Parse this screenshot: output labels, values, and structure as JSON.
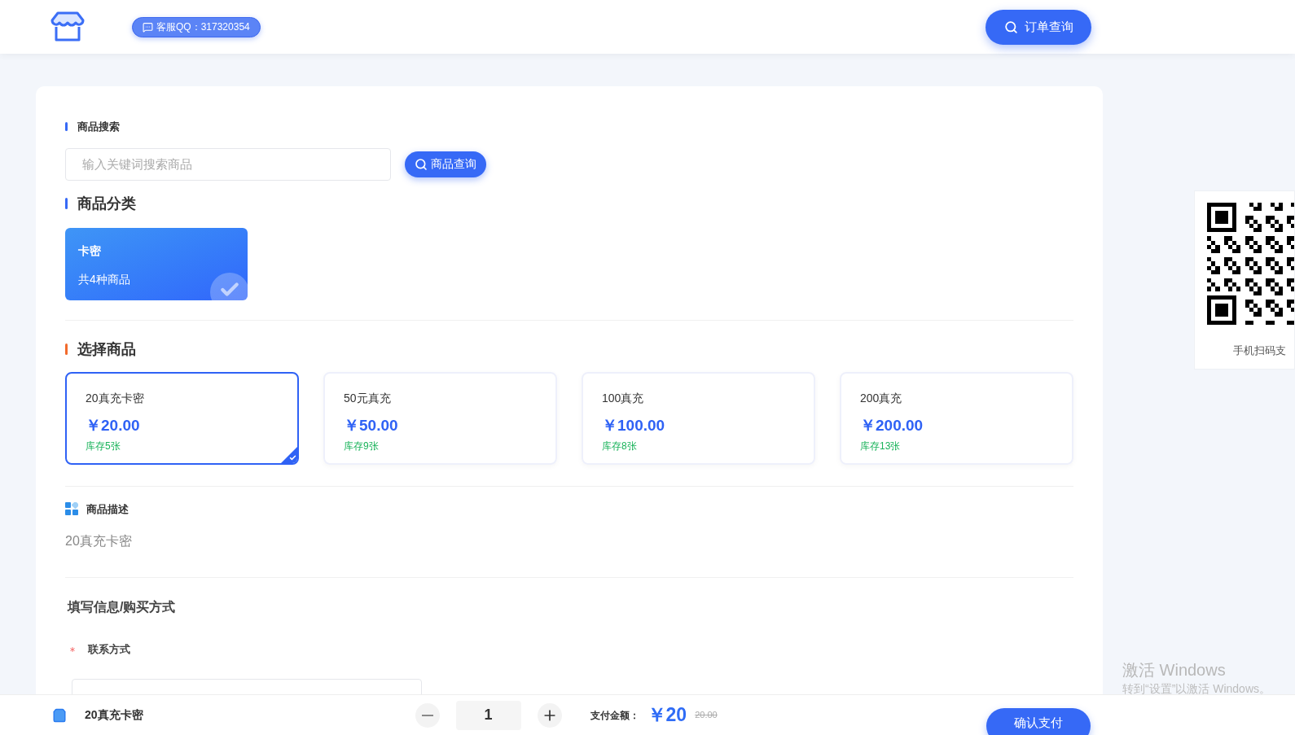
{
  "header": {
    "support": "客服QQ：317320354",
    "order_button": "订单查询"
  },
  "search": {
    "title": "商品搜索",
    "placeholder": "输入关键词搜索商品",
    "button": "商品查询"
  },
  "categories": {
    "title": "商品分类",
    "items": [
      {
        "name": "卡密",
        "count": "共4种商品",
        "selected": true
      }
    ]
  },
  "products": {
    "title": "选择商品",
    "items": [
      {
        "name": "20真充卡密",
        "price": "￥20.00",
        "stock": "库存5张",
        "selected": true
      },
      {
        "name": "50元真充",
        "price": "￥50.00",
        "stock": "库存9张",
        "selected": false
      },
      {
        "name": "100真充",
        "price": "￥100.00",
        "stock": "库存8张",
        "selected": false
      },
      {
        "name": "200真充",
        "price": "￥200.00",
        "stock": "库存13张",
        "selected": false
      }
    ]
  },
  "description": {
    "title": "商品描述",
    "text": "20真充卡密"
  },
  "form": {
    "title": "填写信息/购买方式",
    "fields": [
      {
        "label": "联系方式",
        "required": true
      }
    ]
  },
  "qr_panel": {
    "caption": "手机扫码支"
  },
  "bottom_bar": {
    "product": "20真充卡密",
    "quantity": "1",
    "total_label": "支付金额：",
    "total": "￥20",
    "original": "20.00",
    "pay_button": "确认支付"
  },
  "system_notice": {
    "title": "激活 Windows",
    "text": "转到“设置”以激活 Windows。"
  }
}
